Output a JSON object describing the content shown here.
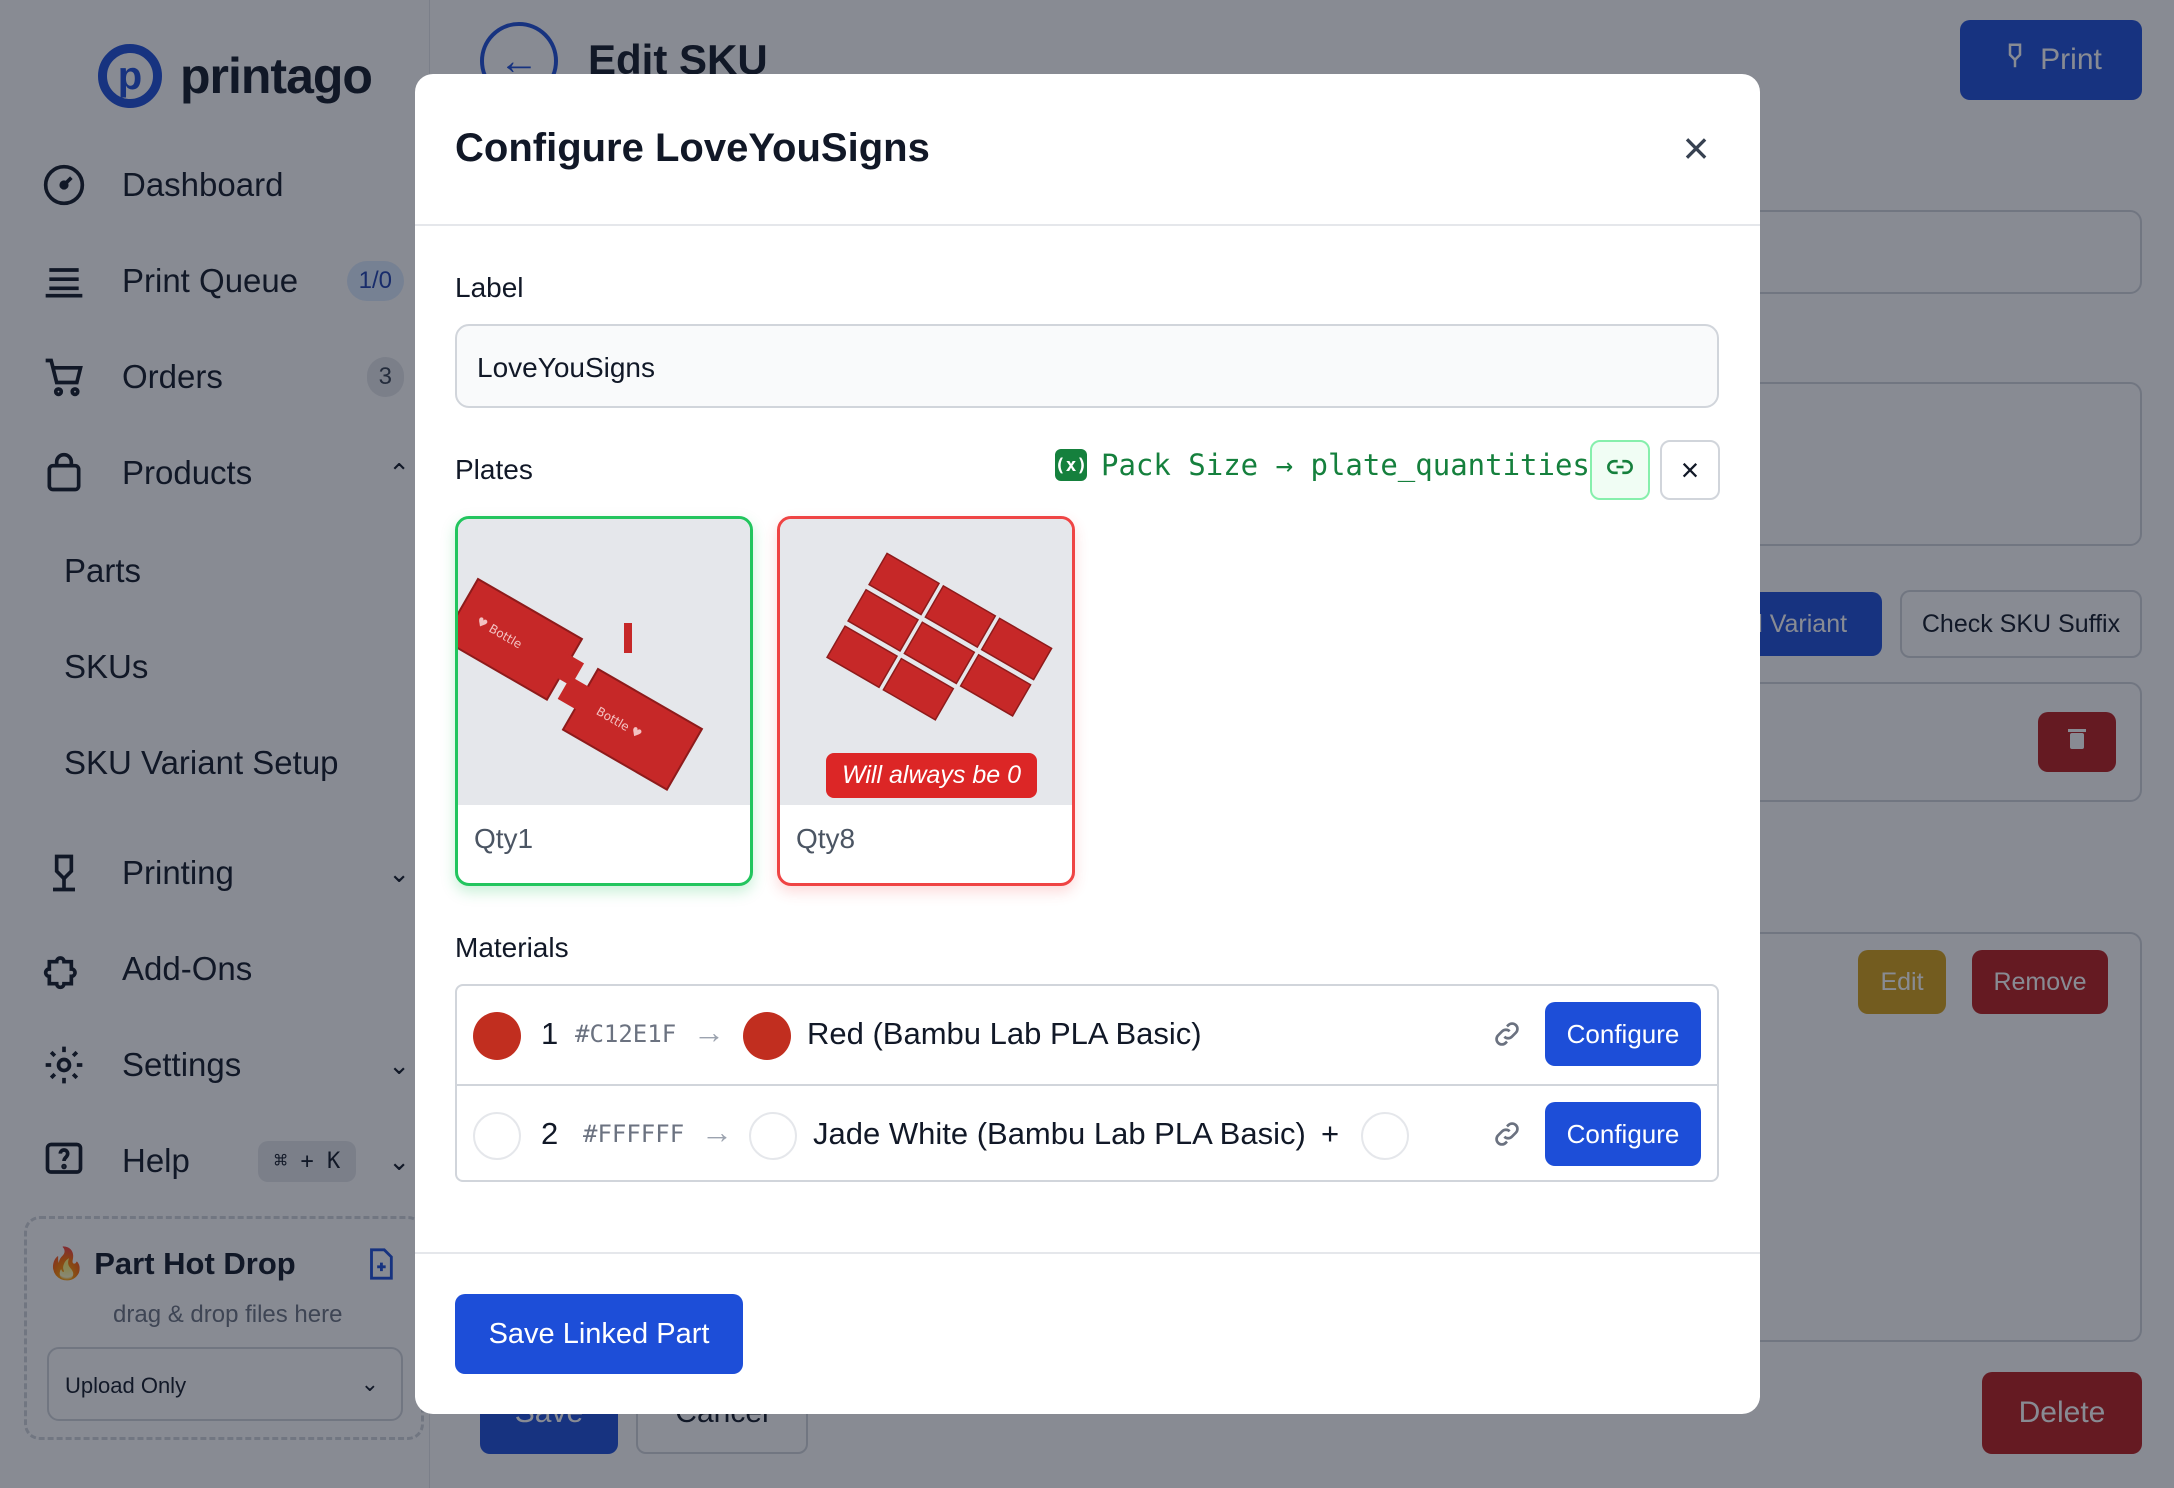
{
  "app": {
    "logo_text": "printago",
    "logo_letter": "p"
  },
  "sidebar": {
    "items": [
      {
        "label": "Dashboard",
        "icon": "dashboard-icon"
      },
      {
        "label": "Print Queue",
        "icon": "queue-icon",
        "badge": "1/0"
      },
      {
        "label": "Orders",
        "icon": "cart-icon",
        "badge": "3"
      },
      {
        "label": "Products",
        "icon": "bag-icon",
        "chevron": "⌃"
      },
      {
        "label": "Printing",
        "icon": "printing-icon",
        "chevron": "⌄"
      },
      {
        "label": "Add-Ons",
        "icon": "puzzle-icon"
      },
      {
        "label": "Settings",
        "icon": "gear-icon",
        "chevron": "⌄"
      },
      {
        "label": "Help",
        "icon": "help-icon",
        "chevron": "⌄",
        "shortcut": "⌘ + K"
      }
    ],
    "sub_items": [
      "Parts",
      "SKUs",
      "SKU Variant Setup"
    ],
    "hot_drop": {
      "title": "Part Hot Drop",
      "subtitle": "drag & drop files here",
      "select_value": "Upload Only",
      "fire": "🔥"
    }
  },
  "page": {
    "title": "Edit SKU",
    "print_label": "Print",
    "add_variant_label": "dd Variant",
    "check_suffix_label": "Check SKU Suffix",
    "edit_label": "Edit",
    "remove_label": "Remove",
    "save_label": "Save",
    "cancel_label": "Cancel",
    "delete_label": "Delete"
  },
  "modal": {
    "title": "Configure LoveYouSigns",
    "close": "×",
    "label_heading": "Label",
    "label_value": "LoveYouSigns",
    "plates_heading": "Plates",
    "variable_badge": "(x)",
    "mapping": "Pack Size → plate_quantities",
    "plates": [
      {
        "qty": "Qty1",
        "status": "ok"
      },
      {
        "qty": "Qty8",
        "status": "error",
        "warning": "Will always be 0"
      }
    ],
    "materials_heading": "Materials",
    "materials": [
      {
        "index": "1",
        "hex": "#C12E1F",
        "arrow": "→",
        "color": "#C12E1F",
        "name": "Red (Bambu Lab PLA Basic)",
        "configure": "Configure"
      },
      {
        "index": "2",
        "hex": "#FFFFFF",
        "arrow": "→",
        "color": "#FFFFFF",
        "name": "Jade White (Bambu Lab PLA Basic)",
        "plus": "+",
        "configure": "Configure"
      }
    ],
    "save_label": "Save Linked Part"
  },
  "colors": {
    "primary": "#1d4ed8",
    "success": "#22c55e",
    "danger": "#dc2626",
    "accent_red": "#C12E1F"
  }
}
